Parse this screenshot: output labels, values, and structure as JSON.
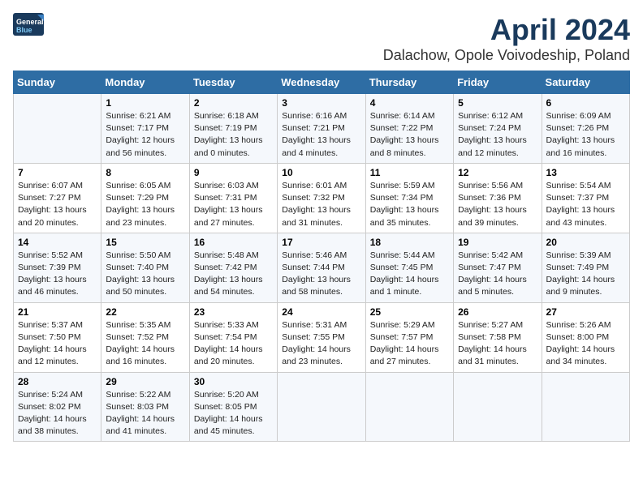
{
  "header": {
    "logo_line1": "General",
    "logo_line2": "Blue",
    "month": "April 2024",
    "location": "Dalachow, Opole Voivodeship, Poland"
  },
  "weekdays": [
    "Sunday",
    "Monday",
    "Tuesday",
    "Wednesday",
    "Thursday",
    "Friday",
    "Saturday"
  ],
  "weeks": [
    [
      {
        "day": "",
        "sunrise": "",
        "sunset": "",
        "daylight": ""
      },
      {
        "day": "1",
        "sunrise": "6:21 AM",
        "sunset": "7:17 PM",
        "daylight": "12 hours and 56 minutes."
      },
      {
        "day": "2",
        "sunrise": "6:18 AM",
        "sunset": "7:19 PM",
        "daylight": "13 hours and 0 minutes."
      },
      {
        "day": "3",
        "sunrise": "6:16 AM",
        "sunset": "7:21 PM",
        "daylight": "13 hours and 4 minutes."
      },
      {
        "day": "4",
        "sunrise": "6:14 AM",
        "sunset": "7:22 PM",
        "daylight": "13 hours and 8 minutes."
      },
      {
        "day": "5",
        "sunrise": "6:12 AM",
        "sunset": "7:24 PM",
        "daylight": "13 hours and 12 minutes."
      },
      {
        "day": "6",
        "sunrise": "6:09 AM",
        "sunset": "7:26 PM",
        "daylight": "13 hours and 16 minutes."
      }
    ],
    [
      {
        "day": "7",
        "sunrise": "6:07 AM",
        "sunset": "7:27 PM",
        "daylight": "13 hours and 20 minutes."
      },
      {
        "day": "8",
        "sunrise": "6:05 AM",
        "sunset": "7:29 PM",
        "daylight": "13 hours and 23 minutes."
      },
      {
        "day": "9",
        "sunrise": "6:03 AM",
        "sunset": "7:31 PM",
        "daylight": "13 hours and 27 minutes."
      },
      {
        "day": "10",
        "sunrise": "6:01 AM",
        "sunset": "7:32 PM",
        "daylight": "13 hours and 31 minutes."
      },
      {
        "day": "11",
        "sunrise": "5:59 AM",
        "sunset": "7:34 PM",
        "daylight": "13 hours and 35 minutes."
      },
      {
        "day": "12",
        "sunrise": "5:56 AM",
        "sunset": "7:36 PM",
        "daylight": "13 hours and 39 minutes."
      },
      {
        "day": "13",
        "sunrise": "5:54 AM",
        "sunset": "7:37 PM",
        "daylight": "13 hours and 43 minutes."
      }
    ],
    [
      {
        "day": "14",
        "sunrise": "5:52 AM",
        "sunset": "7:39 PM",
        "daylight": "13 hours and 46 minutes."
      },
      {
        "day": "15",
        "sunrise": "5:50 AM",
        "sunset": "7:40 PM",
        "daylight": "13 hours and 50 minutes."
      },
      {
        "day": "16",
        "sunrise": "5:48 AM",
        "sunset": "7:42 PM",
        "daylight": "13 hours and 54 minutes."
      },
      {
        "day": "17",
        "sunrise": "5:46 AM",
        "sunset": "7:44 PM",
        "daylight": "13 hours and 58 minutes."
      },
      {
        "day": "18",
        "sunrise": "5:44 AM",
        "sunset": "7:45 PM",
        "daylight": "14 hours and 1 minute."
      },
      {
        "day": "19",
        "sunrise": "5:42 AM",
        "sunset": "7:47 PM",
        "daylight": "14 hours and 5 minutes."
      },
      {
        "day": "20",
        "sunrise": "5:39 AM",
        "sunset": "7:49 PM",
        "daylight": "14 hours and 9 minutes."
      }
    ],
    [
      {
        "day": "21",
        "sunrise": "5:37 AM",
        "sunset": "7:50 PM",
        "daylight": "14 hours and 12 minutes."
      },
      {
        "day": "22",
        "sunrise": "5:35 AM",
        "sunset": "7:52 PM",
        "daylight": "14 hours and 16 minutes."
      },
      {
        "day": "23",
        "sunrise": "5:33 AM",
        "sunset": "7:54 PM",
        "daylight": "14 hours and 20 minutes."
      },
      {
        "day": "24",
        "sunrise": "5:31 AM",
        "sunset": "7:55 PM",
        "daylight": "14 hours and 23 minutes."
      },
      {
        "day": "25",
        "sunrise": "5:29 AM",
        "sunset": "7:57 PM",
        "daylight": "14 hours and 27 minutes."
      },
      {
        "day": "26",
        "sunrise": "5:27 AM",
        "sunset": "7:58 PM",
        "daylight": "14 hours and 31 minutes."
      },
      {
        "day": "27",
        "sunrise": "5:26 AM",
        "sunset": "8:00 PM",
        "daylight": "14 hours and 34 minutes."
      }
    ],
    [
      {
        "day": "28",
        "sunrise": "5:24 AM",
        "sunset": "8:02 PM",
        "daylight": "14 hours and 38 minutes."
      },
      {
        "day": "29",
        "sunrise": "5:22 AM",
        "sunset": "8:03 PM",
        "daylight": "14 hours and 41 minutes."
      },
      {
        "day": "30",
        "sunrise": "5:20 AM",
        "sunset": "8:05 PM",
        "daylight": "14 hours and 45 minutes."
      },
      {
        "day": "",
        "sunrise": "",
        "sunset": "",
        "daylight": ""
      },
      {
        "day": "",
        "sunrise": "",
        "sunset": "",
        "daylight": ""
      },
      {
        "day": "",
        "sunrise": "",
        "sunset": "",
        "daylight": ""
      },
      {
        "day": "",
        "sunrise": "",
        "sunset": "",
        "daylight": ""
      }
    ]
  ]
}
